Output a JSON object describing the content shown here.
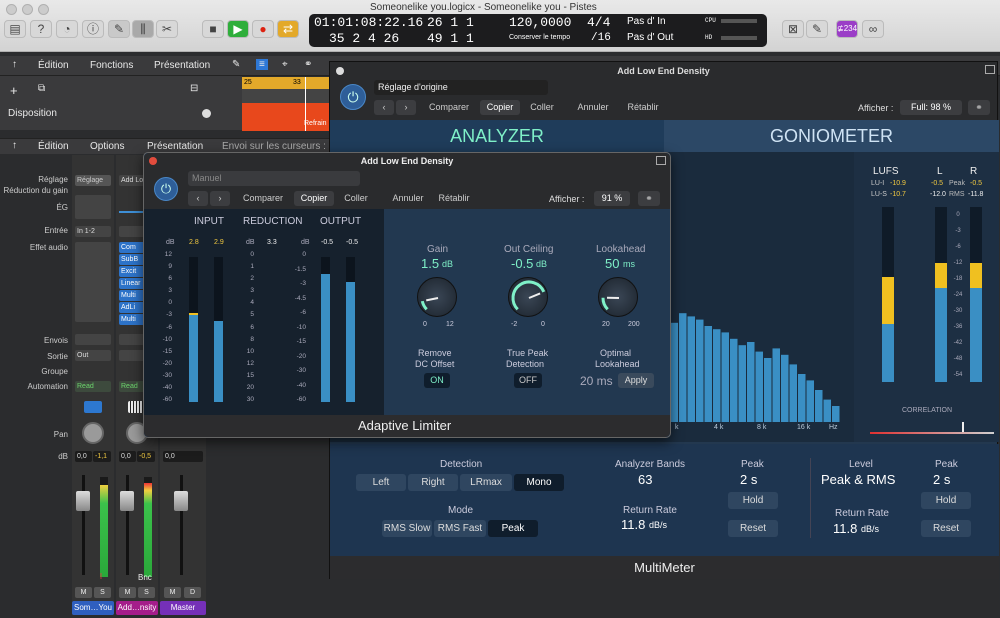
{
  "window": {
    "title": "Someonelike you.logicx - Someonelike you - Pistes"
  },
  "lcd": {
    "time": "01:01:08:22.16",
    "bars": "35  2  4  26",
    "loc1": "26  1  1",
    "loc2": "49  1  1",
    "loc1_b": "1",
    "loc2_b": "1",
    "tempo": "120,0000",
    "tempo_label": "Conserver le tempo",
    "sig": "4/4",
    "div": "/16",
    "in": "Pas d' In",
    "out": "Pas d' Out",
    "cpu": "CPU",
    "hd": "HD"
  },
  "badge": "⊈234",
  "toolbar": {
    "edition": "Édition",
    "fonctions": "Fonctions",
    "presentation": "Présentation"
  },
  "region": {
    "ruler_5": "25",
    "ruler_33": "33",
    "label": "Refrain"
  },
  "disposition": "Disposition",
  "mixer_bar": {
    "edition": "Édition",
    "options": "Options",
    "presentation": "Présentation",
    "envoi": "Envoi sur les curseurs :"
  },
  "row_labels": {
    "reglage": "Réglage",
    "reduction": "Réduction du gain",
    "eg": "ÉG",
    "entree": "Entrée",
    "effet": "Effet audio",
    "envois": "Envois",
    "sortie": "Sortie",
    "groupe": "Groupe",
    "automation": "Automation",
    "pan": "Pan",
    "db": "dB"
  },
  "strips": [
    {
      "reglage": "Réglage",
      "entree": "In 1-2",
      "sortie": "Out",
      "auto": "Read",
      "db1": "0,0",
      "db2": "-1,1",
      "ms_m": "M",
      "ms_s": "S",
      "name": "Som…You",
      "rec": "I"
    },
    {
      "reglage": "Add Lo",
      "auto": "Read",
      "db1": "0,0",
      "db2": "-0,5",
      "ms_m": "M",
      "ms_s": "S",
      "name": "Add…nsity",
      "bnc": "Bnc"
    },
    {
      "db1": "0,0",
      "ms_m": "M",
      "ms_s": "D",
      "name": "Master"
    }
  ],
  "inserts": [
    "Com",
    "SubB",
    "Excit",
    "Linear",
    "Multi",
    "AdLi",
    "Multi"
  ],
  "multimeter": {
    "title": "Add Low End Density",
    "preset": "Réglage d'origine",
    "comparer": "Comparer",
    "copier": "Copier",
    "coller": "Coller",
    "annuler": "Annuler",
    "retablir": "Rétablir",
    "afficher": "Afficher :",
    "zoom": "Full: 98 %",
    "tab_analyzer": "ANALYZER",
    "tab_gonio": "GONIOMETER",
    "lufs": "LUFS",
    "lu_i": "LU-I",
    "lu_s": "LU-S",
    "lu_i_val": "-10.9",
    "lu_s_val": "-10.7",
    "l": "L",
    "r": "R",
    "peak": "Peak",
    "rms": "RMS",
    "l_peak": "-0.5",
    "r_peak": "-0.5",
    "l_rms": "-12.0",
    "r_rms": "-11.8",
    "meter_ticks": [
      "0",
      "-3",
      "-6",
      "-12",
      "-18",
      "-24",
      "-30",
      "-36",
      "-42",
      "-48",
      "-54"
    ],
    "correlation": "CORRELATION",
    "freq_ticks": [
      "k",
      "4 k",
      "8 k",
      "16 k",
      "Hz"
    ],
    "detection": "Detection",
    "det_left": "Left",
    "det_right": "Right",
    "det_lrmax": "LRmax",
    "det_mono": "Mono",
    "mode": "Mode",
    "mode_rmsslow": "RMS Slow",
    "mode_rmsfast": "RMS Fast",
    "mode_peak": "Peak",
    "bands_label": "Analyzer Bands",
    "bands": "63",
    "return_label": "Return Rate",
    "return": "11.8",
    "return_unit": "dB/s",
    "peak_label": "Peak",
    "peak_val": "2 s",
    "hold": "Hold",
    "reset": "Reset",
    "level_label": "Level",
    "level_val": "Peak & RMS",
    "peak2_label": "Peak",
    "peak2_val": "2 s",
    "return2_label": "Return Rate",
    "return2": "11.8",
    "return2_unit": "dB/s",
    "hold2": "Hold",
    "reset2": "Reset",
    "footer": "MultiMeter",
    "spectrum": [
      0.62,
      0.68,
      0.66,
      0.64,
      0.6,
      0.58,
      0.56,
      0.52,
      0.48,
      0.5,
      0.44,
      0.4,
      0.46,
      0.42,
      0.36,
      0.3,
      0.26,
      0.2,
      0.14,
      0.1
    ],
    "l_level": 0.68,
    "r_level": 0.68,
    "l_rms_level": 0.54,
    "r_rms_level": 0.54
  },
  "limiter": {
    "title": "Add Low End Density",
    "preset": "Manuel",
    "comparer": "Comparer",
    "copier": "Copier",
    "coller": "Coller",
    "annuler": "Annuler",
    "retablir": "Rétablir",
    "afficher": "Afficher :",
    "zoom": "91 %",
    "input": "INPUT",
    "reduction": "REDUCTION",
    "output": "OUTPUT",
    "db": "dB",
    "in_l": "2.8",
    "in_r": "2.9",
    "red": "3.3",
    "out_l": "-0.5",
    "out_r": "-0.5",
    "in_ticks": [
      "12",
      "9",
      "6",
      "3",
      "0",
      "-3",
      "-6",
      "-10",
      "-15",
      "-20",
      "-30",
      "-40",
      "-60"
    ],
    "red_ticks": [
      "0",
      "1",
      "2",
      "3",
      "4",
      "5",
      "6",
      "8",
      "10",
      "12",
      "15",
      "20",
      "30"
    ],
    "out_ticks": [
      "0",
      "-1.5",
      "-3",
      "-4.5",
      "-6",
      "-10",
      "-15",
      "-20",
      "-30",
      "-40",
      "-60"
    ],
    "in_l_level": 0.6,
    "in_r_level": 0.56,
    "out_l_level": 0.88,
    "out_r_level": 0.83,
    "gain_label": "Gain",
    "gain_val": "1.5",
    "gain_unit": "dB",
    "gain_min": "0",
    "gain_max": "12",
    "gain_level": 0.125,
    "ceiling_label": "Out Ceiling",
    "ceiling_val": "-0.5",
    "ceiling_unit": "dB",
    "ceiling_min": "-2",
    "ceiling_max": "0",
    "ceiling_level": 0.75,
    "look_label": "Lookahead",
    "look_val": "50",
    "look_unit": "ms",
    "look_min": "20",
    "look_max": "200",
    "look_level": 0.17,
    "dc_label1": "Remove",
    "dc_label2": "DC Offset",
    "dc_val": "ON",
    "tp_label1": "True Peak",
    "tp_label2": "Detection",
    "tp_val": "OFF",
    "opt_label1": "Optimal",
    "opt_label2": "Lookahead",
    "opt_val": "20 ms",
    "apply": "Apply",
    "footer": "Adaptive Limiter"
  }
}
